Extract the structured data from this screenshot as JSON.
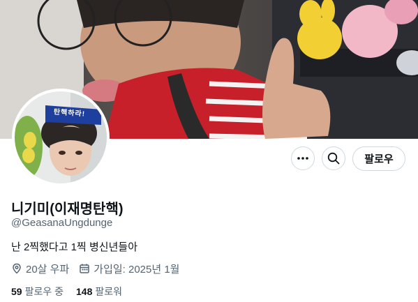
{
  "profile": {
    "display_name": "니기미(이재명탄핵)",
    "handle": "@GeasanaUngdunge",
    "bio": "난 2찍했다고 1찍 병신년들아",
    "location": "20살 우파",
    "joined": "가입일: 2025년 1월",
    "following_count": "59",
    "following_label": "팔로우 중",
    "followers_count": "148",
    "followers_label": "팔로워",
    "avatar_cap_text": "탄핵하라!"
  },
  "actions": {
    "more_icon": "more-dots-icon",
    "search_icon": "search-icon",
    "follow_label": "팔로우"
  },
  "icons": {
    "location": "location-pin-icon",
    "calendar": "calendar-icon"
  },
  "colors": {
    "text_primary": "#0f1419",
    "text_secondary": "#536471",
    "border": "#cfd9de",
    "banner_shirt_red": "#c8202a",
    "cap_blue": "#1f3f9f"
  }
}
